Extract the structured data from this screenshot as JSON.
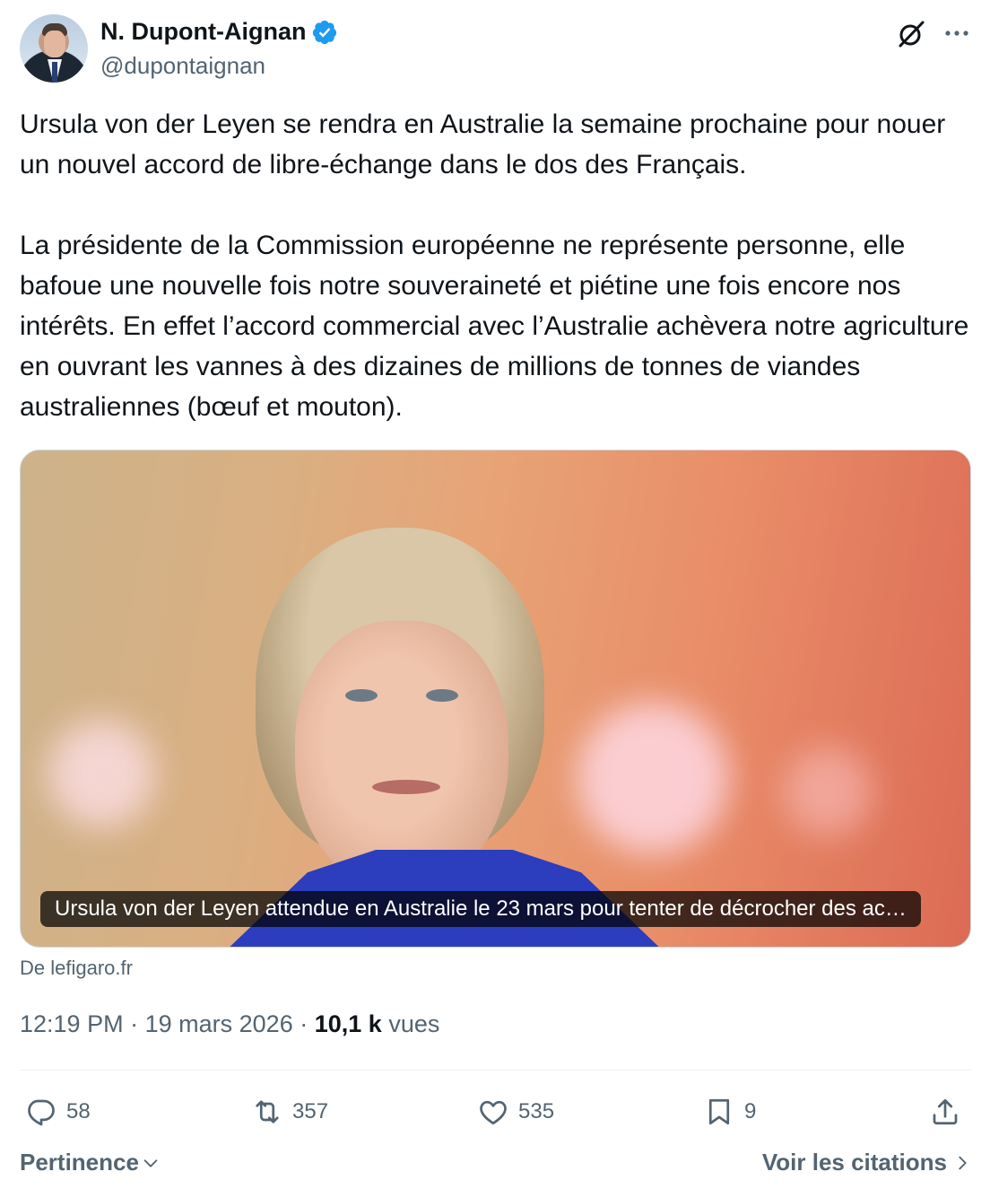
{
  "author": {
    "display_name": "N. Dupont-Aignan",
    "handle": "@dupontaignan",
    "verified": true
  },
  "tweet": {
    "paragraphs": [
      "Ursula von der Leyen se rendra en Australie la semaine prochaine pour nouer un nouvel accord de libre-échange dans le dos des Français.",
      "La présidente de la Commission européenne ne représente personne, elle bafoue une nouvelle fois notre souveraineté et piétine une fois encore nos intérêts. En effet l’accord commercial avec l’Australie achèvera notre agriculture en ouvrant les vannes à des dizaines de millions de tonnes de viandes australiennes (bœuf et mouton)."
    ]
  },
  "card": {
    "caption": "Ursula von der Leyen attendue en Australie le 23 mars pour tenter de décrocher des ac…",
    "source": "De lefigaro.fr"
  },
  "meta": {
    "time": "12:19 PM",
    "separator": "·",
    "date": "19 mars 2026",
    "views_count": "10,1 k",
    "views_label": "vues"
  },
  "actions": {
    "replies": "58",
    "reposts": "357",
    "likes": "535",
    "bookmarks": "9"
  },
  "footer": {
    "sort_label": "Pertinence",
    "quotes_label": "Voir les citations"
  },
  "icons": [
    "verified-badge-icon",
    "grok-icon",
    "more-icon",
    "reply-icon",
    "repost-icon",
    "like-icon",
    "bookmark-icon",
    "share-icon",
    "chevron-down-icon",
    "chevron-right-icon"
  ],
  "colors": {
    "verified": "#1d9bf0",
    "text_primary": "#0f1419",
    "text_secondary": "#536471"
  }
}
